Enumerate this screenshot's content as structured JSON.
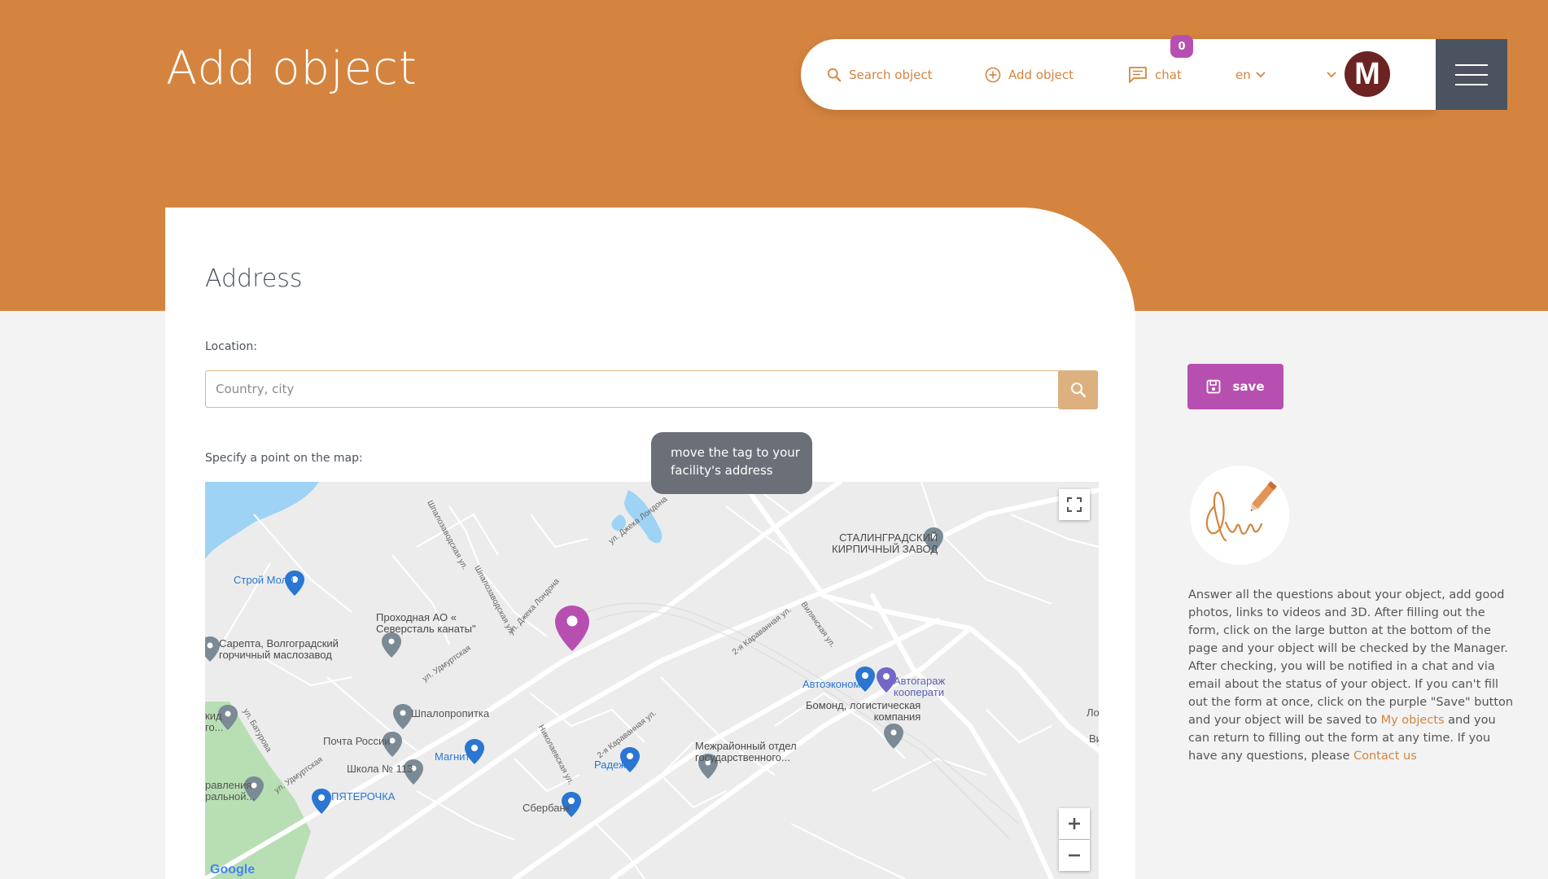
{
  "page": {
    "title": "Add object"
  },
  "nav": {
    "search": "Search object",
    "add": "Add object",
    "chat": "chat",
    "chat_badge": "0",
    "lang": "en",
    "avatar_letter": "M"
  },
  "address": {
    "heading": "Address",
    "location_label": "Location:",
    "location_placeholder": "Country, city",
    "map_label": "Specify a point on the map:",
    "tooltip": "move the tag to your facility's address"
  },
  "map": {
    "labels": {
      "stroy_moll": "Строй Молл",
      "prokhodnaya_1": "Проходная АО «",
      "prokhodnaya_2": "Северсталь канаты\"",
      "sarepta_1": "Сарепта, Волгоградский",
      "sarepta_2": "горчичный маслозавод",
      "stalingrad_1": "СТАЛИНГРАДСКИЙ",
      "stalingrad_2": "КИРПИЧНЫЙ ЗАВОД",
      "shpalopropitka": "Шпалопропитка",
      "pochta": "Почта России",
      "magnit": "Магнит",
      "shkola": "Школа № 113",
      "pyaterochka": "ПЯТЕРОЧКА",
      "avtoekonom": "Автоэконом",
      "avtogarazh_1": "Автогараж",
      "avtogarazh_2": "кооперати",
      "bomond_1": "Бомонд, логистическая",
      "bomond_2": "компания",
      "mezhrayon_1": "Межрайонный отдел",
      "mezhrayon_2": "государственного...",
      "radezh": "Радеж",
      "sberbank": "Сбербанк",
      "left_kid": "кид",
      "left_go": "го...",
      "left_rav": "равления",
      "left_raln": "ральной...",
      "right_lo": "Ло",
      "right_vi": "Ви",
      "google": "Google"
    },
    "streets": {
      "dzheka_1": "ул. Джека Лондона",
      "dzheka_2": "ул. Джека Лондона",
      "udmurt_1": "ул. Удмуртская",
      "udmurt_2": "ул. Удмуртская",
      "karavan_1": "2-я Караванная ул.",
      "karavan_2": "2-я Караванная ул.",
      "vilyan": "Вилянская ул.",
      "shpalo_1": "Шпалозаводская ул.",
      "shpalo_2": "Шпалозаводская ул.",
      "nikolaev": "Николаевская ул.",
      "batkurov": "ул. Батурова"
    }
  },
  "sidebar": {
    "save_label": "save",
    "help_part1": "Answer all the questions about your object, add good photos, links to videos and 3D. After filling out the form, click on the large button at the bottom of the page and your object will be checked by the Manager. After checking, you will be notified in a chat and via email about the status of your object. If you can't fill out the form at once, click on the purple \"Save\" button and your object will be saved to ",
    "help_link1": "My objects",
    "help_part2": " and you can return to filling out the form at any time. If you have any questions, please ",
    "help_link2": "Contact us"
  },
  "colors": {
    "accent_orange": "#d4843f",
    "purple": "#b74fb0",
    "dark_slate": "#4c5360",
    "avatar_bg": "#6b2423"
  },
  "icons": {
    "search": "search-icon",
    "add": "plus-circle-icon",
    "chat": "chat-bubble-icon",
    "chevron": "chevron-down-icon",
    "save": "floppy-disk-icon",
    "map_pin": "map-pin-icon",
    "fullscreen": "fullscreen-icon",
    "signature": "signature-icon"
  }
}
